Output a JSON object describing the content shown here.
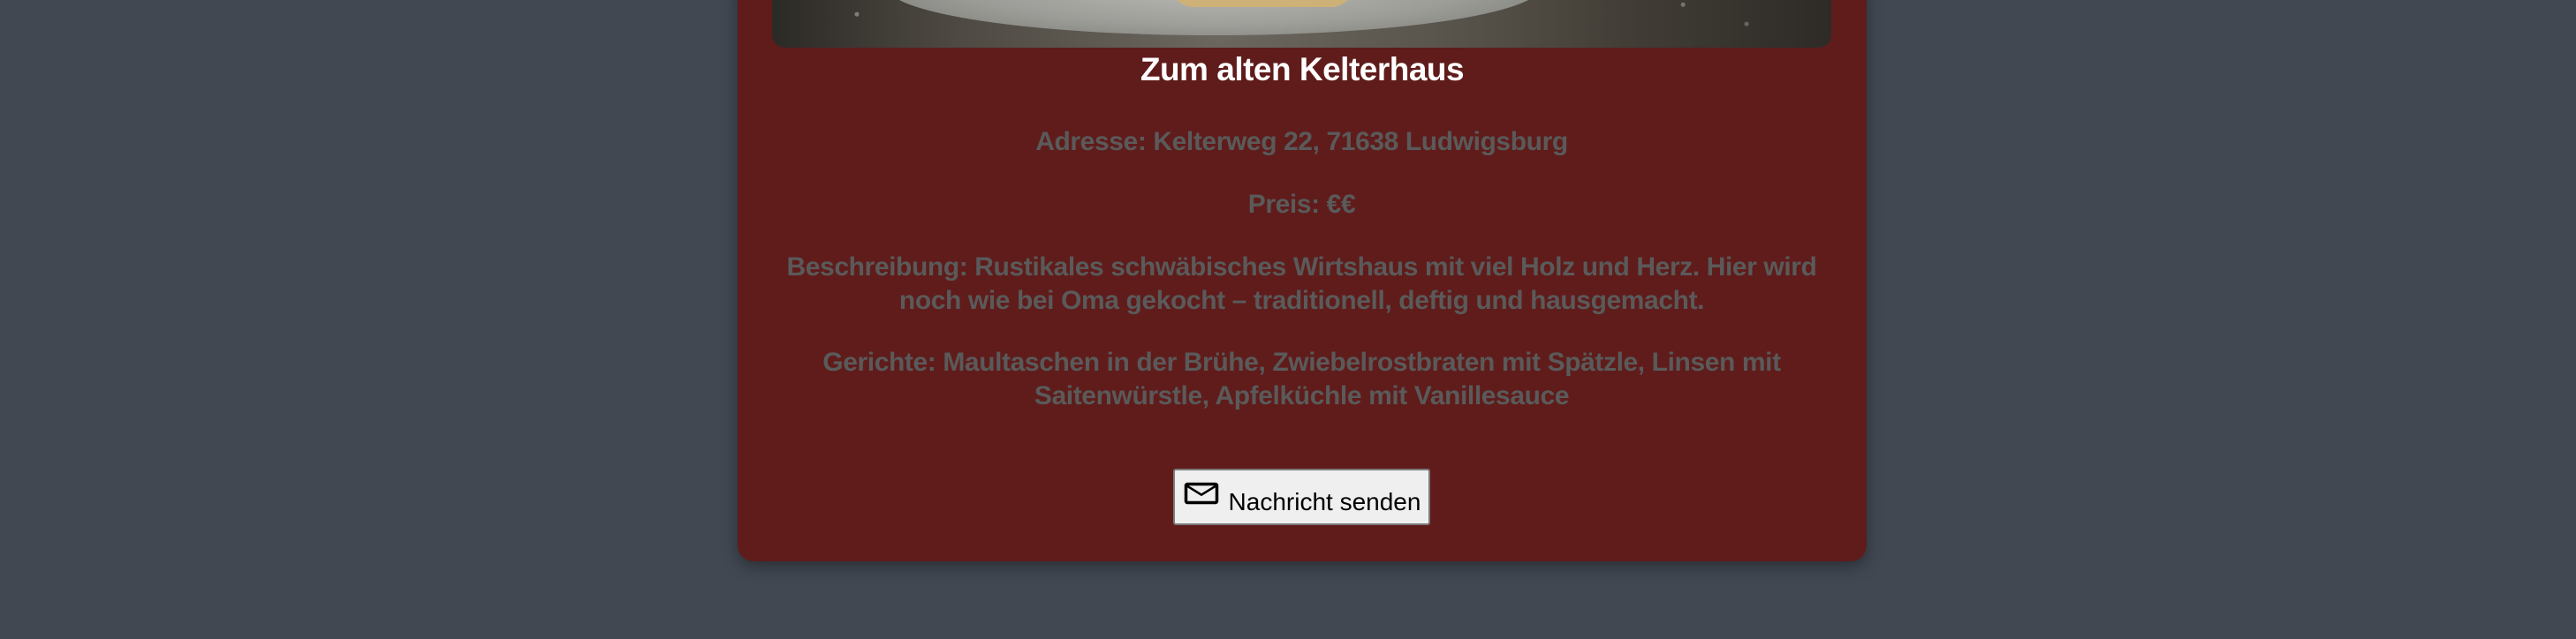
{
  "restaurant": {
    "name": "Zum alten Kelterhaus",
    "address": "Adresse: Kelterweg 22, 71638 Ludwigsburg",
    "price": "Preis: €€",
    "description": "Beschreibung: Rustikales schwäbisches Wirtshaus mit viel Holz und Herz. Hier wird noch wie bei Oma gekocht – traditionell, deftig und hausgemacht.",
    "dishes": "Gerichte: Maultaschen in der Brühe, Zwiebelrostbraten mit Spätzle, Linsen mit Saitenwürstle, Apfelküchle mit Vanillesauce"
  },
  "actions": {
    "send_message_label": "Nachricht senden",
    "send_message_icon": "mail-icon"
  },
  "colors": {
    "page_background": "#414852",
    "card_background": "#5f1c1b",
    "title_text": "#ffffff",
    "detail_text": "#5a5a5a",
    "button_background": "#efefef"
  }
}
